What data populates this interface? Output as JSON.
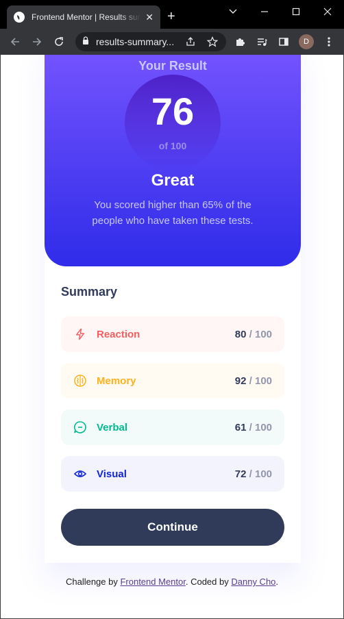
{
  "browser": {
    "tab_title": "Frontend Mentor | Results sum",
    "url": "results-summary...",
    "profile_initial": "D"
  },
  "result": {
    "heading": "Your Result",
    "score": "76",
    "of_text": "of 100",
    "rating": "Great",
    "description": "You scored higher than 65% of the people who have taken these tests."
  },
  "summary": {
    "title": "Summary",
    "items": [
      {
        "label": "Reaction",
        "score": "80",
        "max": " / 100",
        "icon": "lightning-icon",
        "color": "#f55e5e",
        "bg": "#fff6f5"
      },
      {
        "label": "Memory",
        "score": "92",
        "max": " / 100",
        "icon": "brain-icon",
        "color": "#ffb21e",
        "bg": "#fffbf2"
      },
      {
        "label": "Verbal",
        "score": "61",
        "max": " / 100",
        "icon": "chat-icon",
        "color": "#00bb8f",
        "bg": "#f2fbfa"
      },
      {
        "label": "Visual",
        "score": "72",
        "max": " / 100",
        "icon": "eye-icon",
        "color": "#1125d4",
        "bg": "#f3f3fd"
      }
    ]
  },
  "continue_label": "Continue",
  "attribution": {
    "prefix": "Challenge by ",
    "link1": "Frontend Mentor",
    "middle": ". Coded by ",
    "link2": "Danny Cho",
    "suffix": "."
  }
}
